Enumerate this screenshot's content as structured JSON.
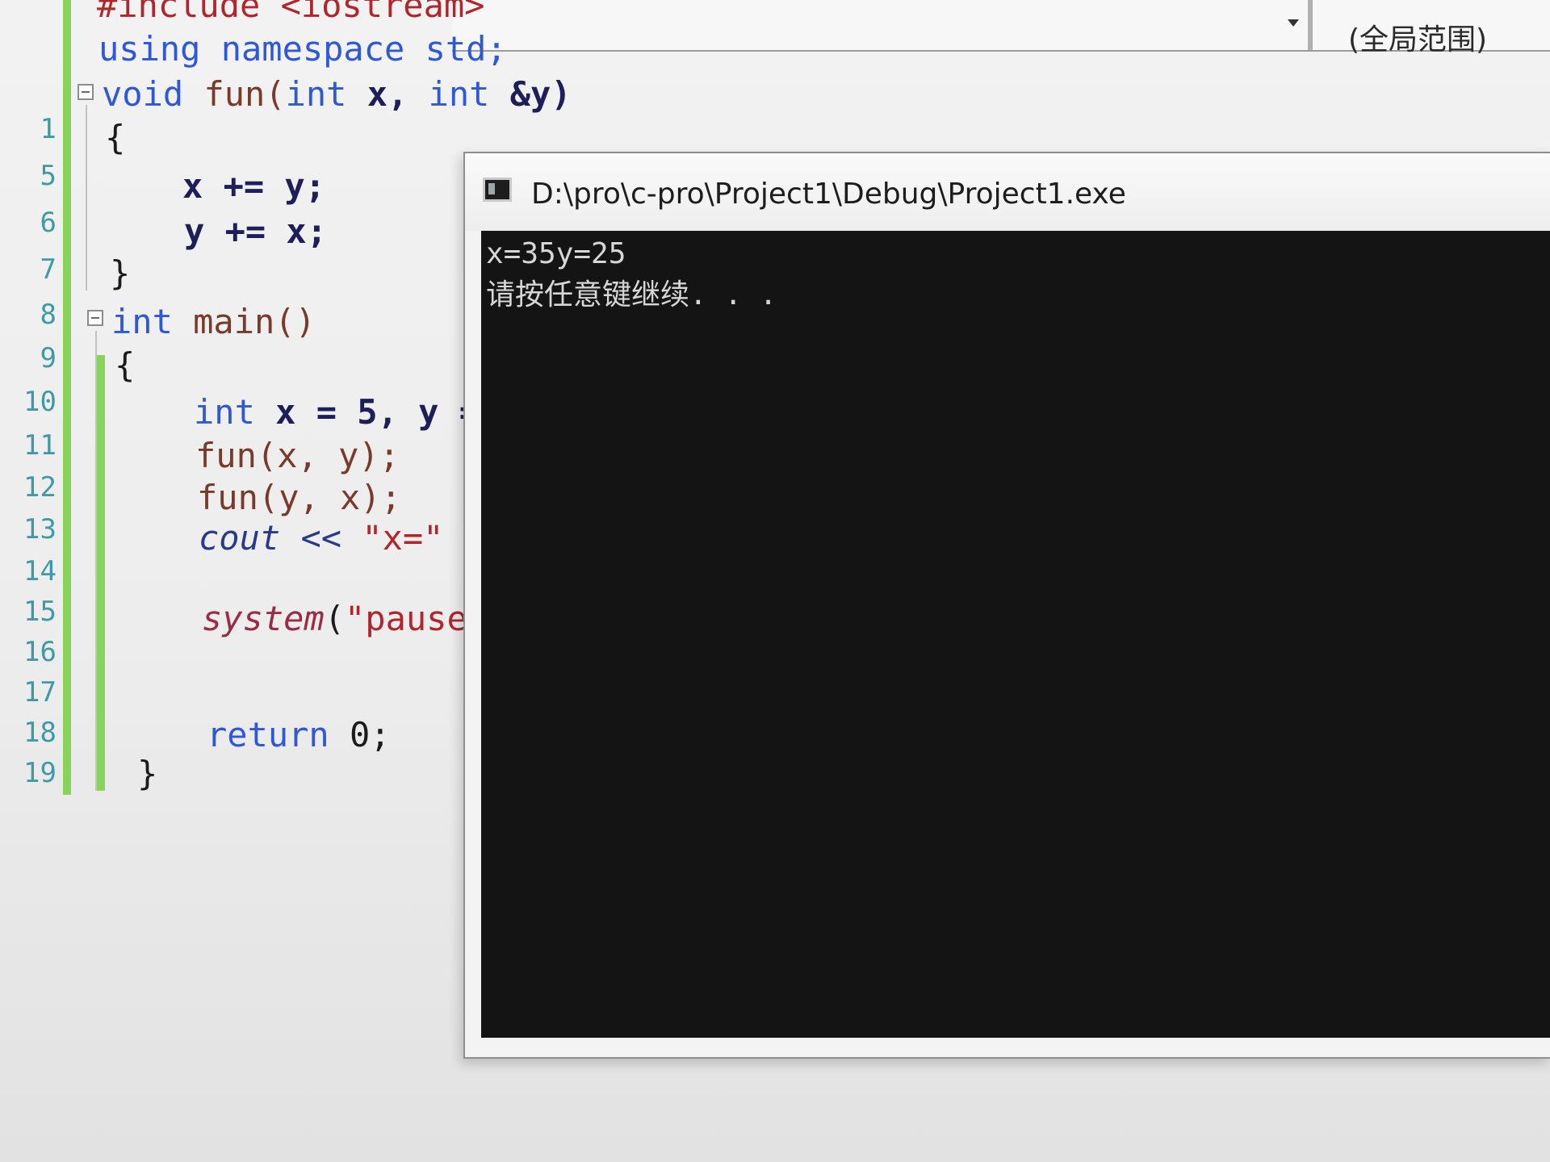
{
  "scope_dropdown": {
    "label": "(全局范围)"
  },
  "editor": {
    "line_numbers": [
      "1",
      "5",
      "6",
      "7",
      "8",
      "9",
      "10",
      "11",
      "12",
      "13",
      "14",
      "15",
      "16",
      "17",
      "18",
      "19"
    ],
    "lines": {
      "include": "#include <iostream>",
      "using": "using namespace std;",
      "fun_decl": {
        "kw": "void",
        "name": " fun(",
        "p1t": "int",
        "p1": " x, ",
        "p2t": "int",
        "p2": " &y)"
      },
      "brace_open_1": "{",
      "stmt_xy": "x += y;",
      "stmt_yx": "y += x;",
      "brace_close_1": "}",
      "main_decl": {
        "kw": "int",
        "rest": " main()"
      },
      "brace_open_2": "{",
      "decl_xy": {
        "kw": "int",
        "rest": " x = 5, y ="
      },
      "call_1": "fun(x, y);",
      "call_2": "fun(y, x);",
      "cout": {
        "kw": "cout",
        "op": " << ",
        "str": "\"x=\"",
        "tail": " <"
      },
      "system": {
        "fn": "system",
        "open": "(",
        "str": "\"pause\""
      },
      "ret": {
        "kw": "return",
        "rest": " 0;"
      },
      "brace_close_2": "}"
    }
  },
  "console": {
    "title": "D:\\pro\\c-pro\\Project1\\Debug\\Project1.exe",
    "output": [
      "x=35y=25",
      "请按任意键继续. . ."
    ],
    "colors": {
      "background": "#141414",
      "text": "#d6d6d6"
    }
  }
}
